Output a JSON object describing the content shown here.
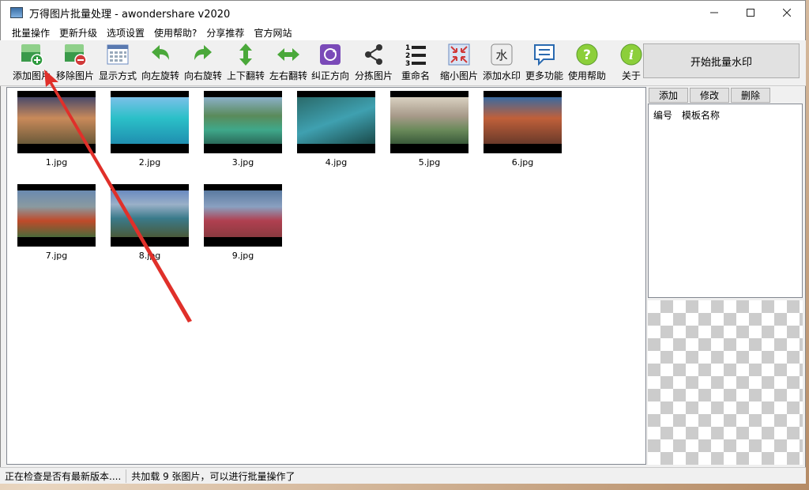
{
  "window": {
    "title": "万得图片批量处理 - awondershare v2020"
  },
  "menu": [
    "批量操作",
    "更新升级",
    "选项设置",
    "使用帮助?",
    "分享推荐",
    "官方网站"
  ],
  "toolbar": {
    "buttons": [
      {
        "label": "添加图片",
        "icon": "add-image-icon"
      },
      {
        "label": "移除图片",
        "icon": "remove-image-icon"
      },
      {
        "label": "显示方式",
        "icon": "view-mode-icon"
      },
      {
        "label": "向左旋转",
        "icon": "rotate-left-icon"
      },
      {
        "label": "向右旋转",
        "icon": "rotate-right-icon"
      },
      {
        "label": "上下翻转",
        "icon": "flip-vertical-icon"
      },
      {
        "label": "左右翻转",
        "icon": "flip-horizontal-icon"
      },
      {
        "label": "纠正方向",
        "icon": "correct-orientation-icon"
      },
      {
        "label": "分拣图片",
        "icon": "sort-images-icon"
      },
      {
        "label": "重命名",
        "icon": "rename-icon"
      },
      {
        "label": "缩小图片",
        "icon": "shrink-image-icon"
      },
      {
        "label": "添加水印",
        "icon": "watermark-icon"
      },
      {
        "label": "更多功能",
        "icon": "more-features-icon"
      },
      {
        "label": "使用帮助",
        "icon": "help-icon"
      },
      {
        "label": "关于",
        "icon": "about-icon"
      }
    ],
    "watermark_icon_text": "水",
    "rename_icon_numbers": [
      "1",
      "2",
      "3"
    ],
    "help_icon_text": "?",
    "about_icon_text": "i",
    "start_button": "开始批量水印"
  },
  "images": [
    {
      "name": "1.jpg",
      "colors": [
        "#4a4a6a",
        "#c98a5a",
        "#6b5a3a"
      ]
    },
    {
      "name": "2.jpg",
      "colors": [
        "#3aa6d0",
        "#2bc0c8",
        "#1f8fb0"
      ]
    },
    {
      "name": "3.jpg",
      "colors": [
        "#5a8a5a",
        "#3fa88a",
        "#2a6a5a"
      ]
    },
    {
      "name": "4.jpg",
      "colors": [
        "#2a6a6a",
        "#3fa0b0",
        "#1a4a4a"
      ]
    },
    {
      "name": "5.jpg",
      "colors": [
        "#c8c0b0",
        "#6a8a5a",
        "#3a5a3a"
      ]
    },
    {
      "name": "6.jpg",
      "colors": [
        "#3a6aa0",
        "#c0603a",
        "#6a3a2a"
      ]
    },
    {
      "name": "7.jpg",
      "colors": [
        "#6a8ab0",
        "#c04a2a",
        "#4a6a3a"
      ]
    },
    {
      "name": "8.jpg",
      "colors": [
        "#6a8ac0",
        "#3a7a8a",
        "#4a5a3a"
      ]
    },
    {
      "name": "9.jpg",
      "colors": [
        "#5a7aa0",
        "#b04050",
        "#8a3a40"
      ]
    }
  ],
  "side": {
    "tabs": [
      "添加",
      "修改",
      "删除"
    ],
    "columns": [
      "编号",
      "模板名称"
    ]
  },
  "status": {
    "checking": "正在检查是否有最新版本....",
    "loaded": "共加载 9 张图片，可以进行批量操作了"
  },
  "accent": "#e0302a"
}
